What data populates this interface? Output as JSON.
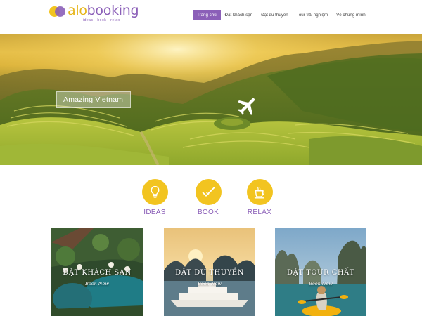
{
  "brand": {
    "logo_alo": "alo",
    "logo_booking": "booking",
    "tagline": "ideas · book · relax",
    "colors": {
      "primary": "#8b5fb8",
      "accent": "#f2c420"
    }
  },
  "nav": {
    "items": [
      {
        "label": "Trang chủ",
        "active": true
      },
      {
        "label": "Đặt khách sạn",
        "active": false
      },
      {
        "label": "Đặt du thuyền",
        "active": false
      },
      {
        "label": "Tour trải nghiệm",
        "active": false
      },
      {
        "label": "Về chúng mình",
        "active": false
      }
    ]
  },
  "hero": {
    "caption": "Amazing Vietnam",
    "icon": "airplane-icon",
    "slide_count": 3,
    "active_slide": 1
  },
  "features": [
    {
      "label": "IDEAS",
      "icon": "lightbulb-icon"
    },
    {
      "label": "BOOK",
      "icon": "checkmark-icon"
    },
    {
      "label": "RELAX",
      "icon": "coffee-cup-icon"
    }
  ],
  "cards": [
    {
      "title": "ĐẶT KHÁCH SẠN",
      "subtitle": "Book Now"
    },
    {
      "title": "ĐẶT DU THUYỀN",
      "subtitle": "Book Now"
    },
    {
      "title": "ĐẶT TOUR CHẤT",
      "subtitle": "Book Now"
    }
  ]
}
